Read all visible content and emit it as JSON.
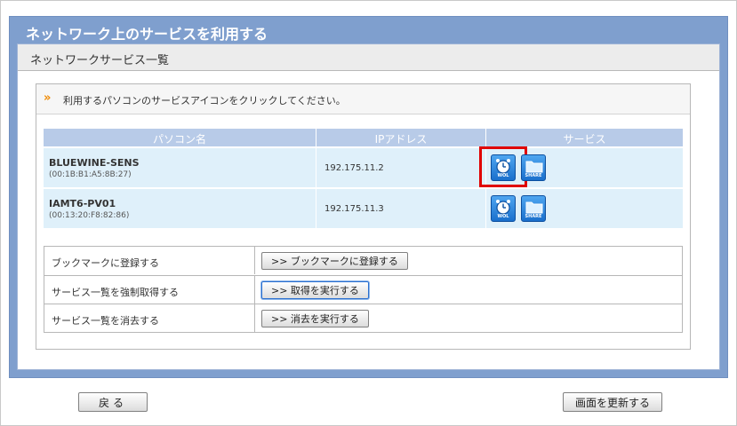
{
  "window": {
    "title": "ネットワーク上のサービスを利用する"
  },
  "section": {
    "title": "ネットワークサービス一覧"
  },
  "instruction": {
    "arrow": "»",
    "text": "利用するパソコンのサービスアイコンをクリックしてください。"
  },
  "table": {
    "headers": {
      "name": "パソコン名",
      "ip": "IPアドレス",
      "service": "サービス"
    },
    "rows": [
      {
        "name": "BLUEWINE-SENS",
        "mac": "(00:1B:B1:A5:8B:27)",
        "ip": "192.175.11.2"
      },
      {
        "name": "IAMT6-PV01",
        "mac": "(00:13:20:F8:82:86)",
        "ip": "192.175.11.3"
      }
    ],
    "service_labels": {
      "wol": "WOL",
      "share": "SHARE"
    }
  },
  "actions": [
    {
      "label": "ブックマークに登録する",
      "button": ">>  ブックマークに登録する"
    },
    {
      "label": "サービス一覧を強制取得する",
      "button": ">>  取得を実行する"
    },
    {
      "label": "サービス一覧を消去する",
      "button": ">>  消去を実行する"
    }
  ],
  "footer": {
    "back": "戻る",
    "refresh": "画面を更新する"
  },
  "colors": {
    "panel": "#7f9fce",
    "header_row": "#b8cbe8",
    "data_row": "#dff0fa",
    "highlight": "#e00000",
    "accent_arrow": "#f08a00"
  },
  "icons": {
    "wol": "alarm-clock-icon",
    "share": "folder-icon"
  }
}
